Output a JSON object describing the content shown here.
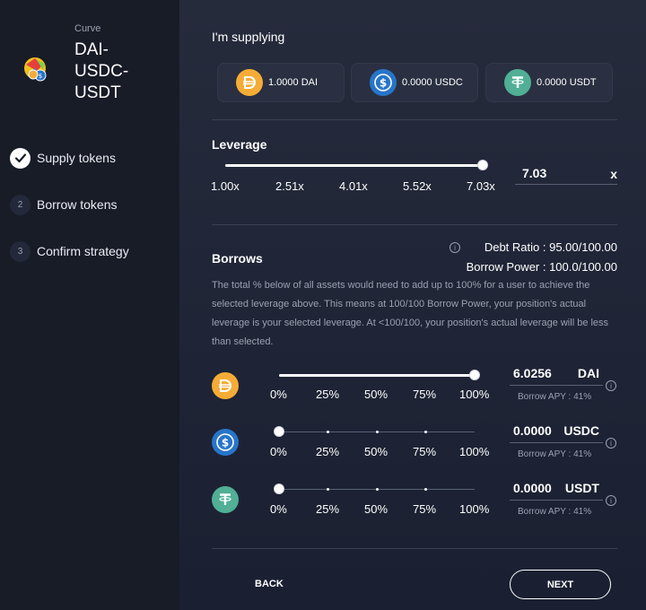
{
  "sidebar": {
    "protocol": "Curve",
    "pool_name": "DAI-\nUSDC-\nUSDT",
    "steps": [
      {
        "number": "",
        "label": "Supply tokens",
        "status": "completed"
      },
      {
        "number": "2",
        "label": "Borrow tokens",
        "status": "pending"
      },
      {
        "number": "3",
        "label": "Confirm strategy",
        "status": "pending"
      }
    ]
  },
  "supply": {
    "title": "I'm supplying",
    "tokens": [
      {
        "symbol": "DAI",
        "amount": "1.0000 DAI",
        "color": "#f5ac37"
      },
      {
        "symbol": "USDC",
        "amount": "0.0000 USDC",
        "color": "#2775ca"
      },
      {
        "symbol": "USDT",
        "amount": "0.0000 USDT",
        "color": "#50af95"
      }
    ]
  },
  "leverage": {
    "title": "Leverage",
    "ticks": [
      "1.00x",
      "2.51x",
      "4.01x",
      "5.52x",
      "7.03x"
    ],
    "value": "7.03",
    "unit": "x",
    "slider_fraction": 1.0
  },
  "borrows": {
    "title": "Borrows",
    "debt_ratio": "Debt Ratio : 95.00/100.00",
    "borrow_power": "Borrow Power : 100.0/100.00",
    "description": "The total % below of all assets would need to add up to 100% for a user to achieve the selected leverage above. This means at 100/100 Borrow Power, your position's actual leverage is your selected leverage. At <100/100, your position's actual leverage will be less than selected.",
    "ticks": [
      "0%",
      "25%",
      "50%",
      "75%",
      "100%"
    ],
    "rows": [
      {
        "symbol": "DAI",
        "value": "6.0256",
        "apy": "Borrow APY : 41%",
        "percent": 100,
        "color": "#f5ac37"
      },
      {
        "symbol": "USDC",
        "value": "0.0000",
        "apy": "Borrow APY : 41%",
        "percent": 0,
        "color": "#2775ca"
      },
      {
        "symbol": "USDT",
        "value": "0.0000",
        "apy": "Borrow APY : 41%",
        "percent": 0,
        "color": "#50af95"
      }
    ]
  },
  "actions": {
    "back": "BACK",
    "next": "NEXT"
  }
}
